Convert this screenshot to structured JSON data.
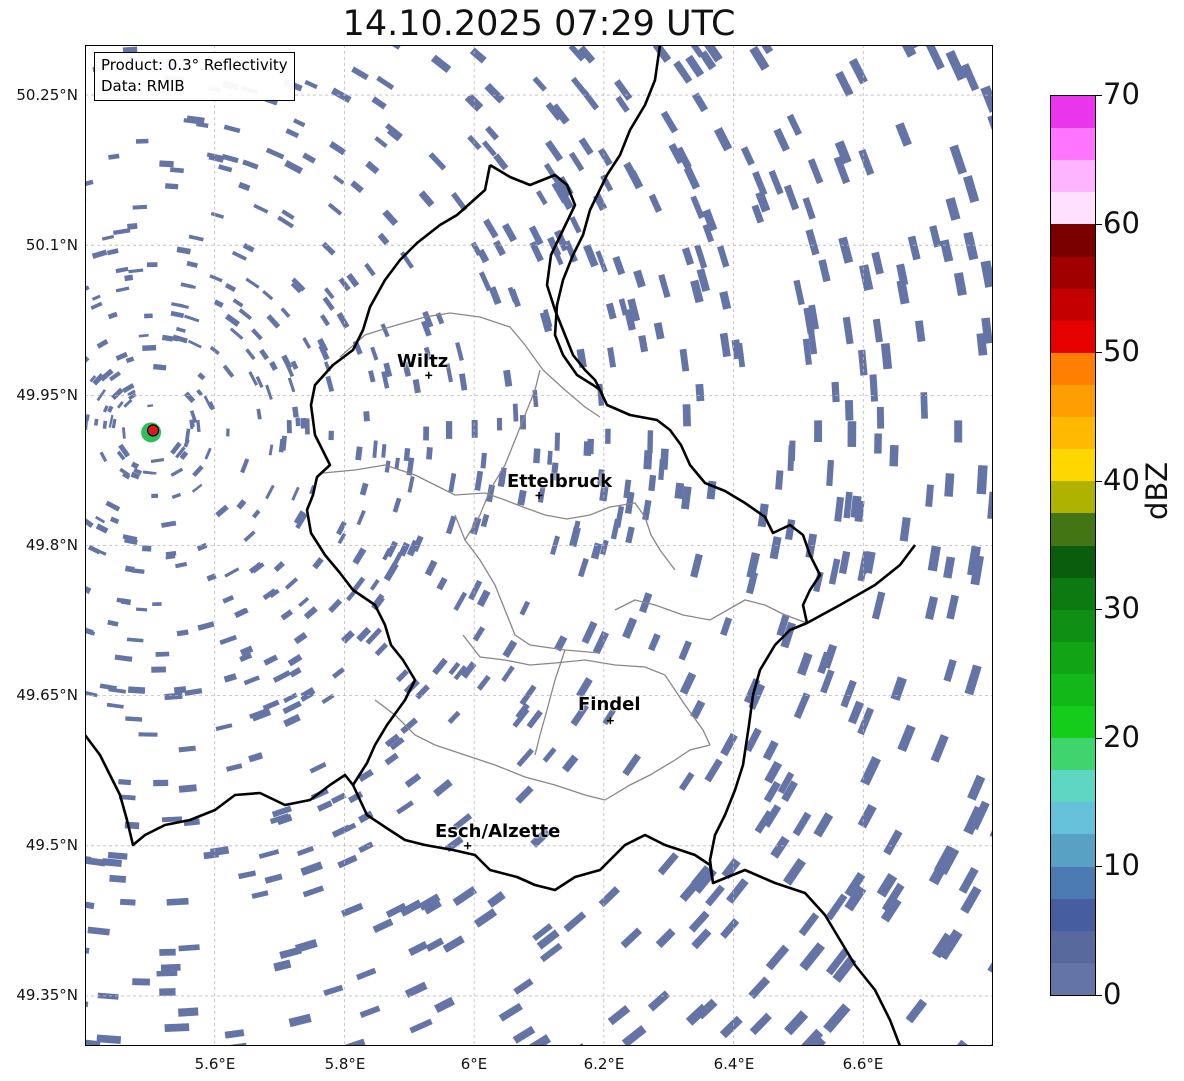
{
  "title": "14.10.2025 07:29 UTC",
  "info": {
    "product": "Product: 0.3° Reflectivity",
    "source": "Data: RMIB"
  },
  "axes": {
    "lat_labels": [
      "50.25°N",
      "50.1°N",
      "49.95°N",
      "49.8°N",
      "49.65°N",
      "49.5°N",
      "49.35°N"
    ],
    "lon_labels": [
      "5.6°E",
      "5.8°E",
      "6°E",
      "6.2°E",
      "6.4°E",
      "6.6°E"
    ],
    "lat_range": [
      49.3,
      50.3
    ],
    "lon_range": [
      5.4,
      6.8
    ]
  },
  "cities": [
    {
      "name": "Wiltz",
      "lon": 5.93,
      "lat": 49.97
    },
    {
      "name": "Ettelbruck",
      "lon": 6.1,
      "lat": 49.85
    },
    {
      "name": "Findel",
      "lon": 6.21,
      "lat": 49.625
    },
    {
      "name": "Esch/Alzette",
      "lon": 5.99,
      "lat": 49.5
    }
  ],
  "radar_site": {
    "lon": 5.505,
    "lat": 49.915
  },
  "colorbar": {
    "label": "dBZ",
    "tick_labels": [
      "0",
      "10",
      "20",
      "30",
      "40",
      "50",
      "60",
      "70"
    ],
    "range": [
      0,
      70
    ],
    "colors": [
      "#6474a6",
      "#57689c",
      "#465e9f",
      "#4b79b2",
      "#58a0c4",
      "#64c1d9",
      "#5ed6c4",
      "#3fd46e",
      "#14cc1a",
      "#12b818",
      "#11a515",
      "#0f8f13",
      "#0c7a10",
      "#0a5d0c",
      "#447515",
      "#adb300",
      "#ffd700",
      "#ffb900",
      "#ff9e00",
      "#ff8000",
      "#e60000",
      "#c40000",
      "#a00000",
      "#7a0000",
      "#ffe0ff",
      "#ffb4ff",
      "#ff75ff",
      "#e935ec"
    ]
  },
  "map_colors": {
    "echo": "#6474a6",
    "border": "#000000",
    "canton": "#888888",
    "grid": "#bbbbbb"
  }
}
